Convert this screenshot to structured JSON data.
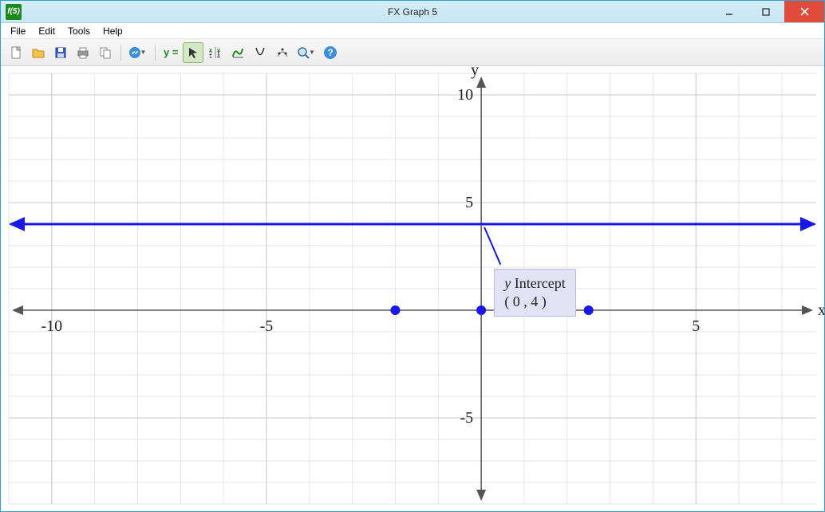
{
  "window": {
    "title": "FX Graph 5",
    "app_icon_text": "f(5)"
  },
  "menu": {
    "file": "File",
    "edit": "Edit",
    "tools": "Tools",
    "help": "Help"
  },
  "toolbar": {
    "new": "new-file-icon",
    "open": "open-folder-icon",
    "save": "save-icon",
    "print": "print-icon",
    "copy": "copy-icon",
    "link": "link-icon",
    "yeq_label": "y =",
    "select": "select-arrow-icon",
    "axes_settings": "axes-settings-icon",
    "curve": "curve-tool-icon",
    "parabola": "parabola-tool-icon",
    "points": "points-tool-icon",
    "zoom": "zoom-icon",
    "help": "help-icon"
  },
  "chart_data": {
    "type": "line",
    "title": "",
    "xlabel": "x",
    "ylabel": "y",
    "xlim": [
      -11,
      7.8
    ],
    "ylim": [
      -9,
      11
    ],
    "xticks": [
      -10,
      -5,
      5
    ],
    "yticks": [
      -5,
      5,
      10
    ],
    "grid": true,
    "series": [
      {
        "name": "y=4",
        "type": "constant-line",
        "y": 4,
        "color": "#1818e8"
      }
    ],
    "points": [
      {
        "x": -2,
        "y": 0,
        "color": "#1818e8"
      },
      {
        "x": 0,
        "y": 0,
        "color": "#1818e8"
      },
      {
        "x": 2.5,
        "y": 0,
        "color": "#1818e8"
      }
    ],
    "annotations": [
      {
        "label_line1": "y Intercept",
        "label_line2": "( 0 , 4 )",
        "target": {
          "x": 0,
          "y": 4
        },
        "box_anchor": {
          "x": 0.3,
          "y": 1.9
        }
      }
    ]
  }
}
